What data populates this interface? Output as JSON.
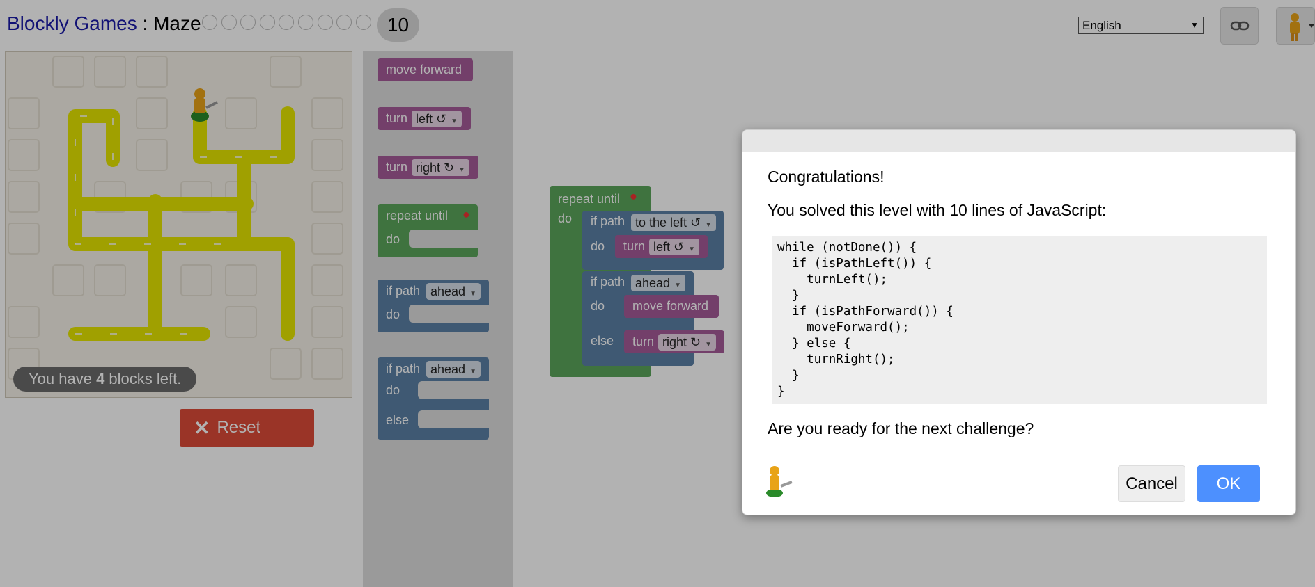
{
  "header": {
    "app_name": "Blockly Games",
    "separator": " : ",
    "game_name": "Maze",
    "level_count": 9,
    "current_level": "10",
    "language": "English",
    "link_icon": "link-icon",
    "pegman_icon": "pegman-icon"
  },
  "maze": {
    "blocks_left_prefix": "You have ",
    "blocks_left_count": "4",
    "blocks_left_suffix": " blocks left.",
    "reset_label": "Reset",
    "path_color": "#e6e600"
  },
  "toolbox": {
    "move_forward": "move forward",
    "turn_left_label": "turn",
    "turn_left_value": "left ↺",
    "turn_right_label": "turn",
    "turn_right_value": "right ↻",
    "repeat_until": "repeat until",
    "repeat_do": "do",
    "if_label": "if path",
    "if_value": "ahead",
    "if_do": "do",
    "ifelse_label": "if path",
    "ifelse_value": "ahead",
    "ifelse_do": "do",
    "ifelse_else": "else"
  },
  "workspace": {
    "repeat_until": "repeat until",
    "repeat_do": "do",
    "if1_label": "if path",
    "if1_value": "to the left ↺",
    "if1_do": "do",
    "turn1_label": "turn",
    "turn1_value": "left ↺",
    "if2_label": "if path",
    "if2_value": "ahead",
    "if2_do": "do",
    "move_forward": "move forward",
    "if2_else": "else",
    "turn2_label": "turn",
    "turn2_value": "right ↻"
  },
  "dialog": {
    "congrats": "Congratulations!",
    "solved": "You solved this level with 10 lines of JavaScript:",
    "code_lines": [
      "while (notDone()) {",
      "  if (isPathLeft()) {",
      "    turnLeft();",
      "  }",
      "  if (isPathForward()) {",
      "    moveForward();",
      "  } else {",
      "    turnRight();",
      "  }",
      "}"
    ],
    "question": "Are you ready for the next challenge?",
    "cancel_label": "Cancel",
    "ok_label": "OK"
  },
  "colors": {
    "ok_button": "#4d90fe",
    "reset_button": "#dd4b39",
    "movement_blocks": "#a55b99",
    "loop_blocks": "#5ba55b",
    "logic_blocks": "#5b80a5"
  }
}
